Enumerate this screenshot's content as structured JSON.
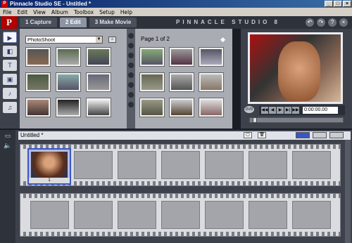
{
  "window": {
    "title": "Pinnacle Studio SE - Untitled *",
    "icon": "studio-logo-icon",
    "min": "_",
    "max": "□",
    "close": "×"
  },
  "menu": [
    "File",
    "Edit",
    "View",
    "Album",
    "Toolbox",
    "Setup",
    "Help"
  ],
  "nav": {
    "tabs": [
      {
        "label": "1 Capture"
      },
      {
        "label": "2 Edit"
      },
      {
        "label": "3 Make Movie"
      }
    ],
    "brand": "PINNACLE STUDIO 8",
    "logo": "P",
    "icons": [
      "undo-icon",
      "redo-icon",
      "help-icon",
      "close-icon"
    ]
  },
  "album": {
    "dropdown_value": "PhotoShoot",
    "page_label": "Page 1 of 2",
    "side_icons": [
      "video-scenes-icon",
      "transitions-icon",
      "titles-icon",
      "photos-icon",
      "sound-effects-icon",
      "music-icon"
    ]
  },
  "preview": {
    "timecode": "0:00:00.00",
    "controls": [
      "rewind-icon",
      "step-back-icon",
      "play-icon",
      "step-forward-icon",
      "fast-forward-icon"
    ]
  },
  "timeline": {
    "title": "Untitled *",
    "clip_label": "1"
  },
  "colors": {
    "accent": "#3a56c4",
    "logo": "#b00000",
    "panel": "#a9acb3"
  }
}
